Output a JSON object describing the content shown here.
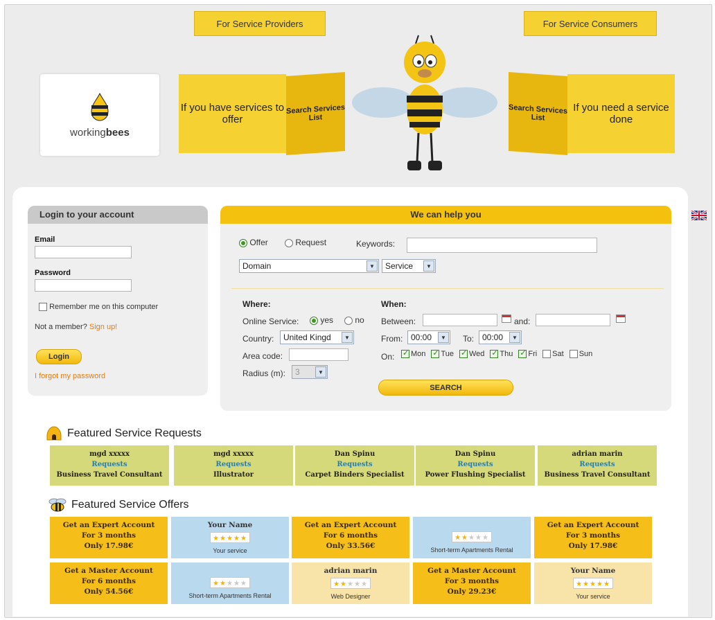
{
  "header": {
    "tab_providers": "For Service Providers",
    "tab_consumers": "For Service Consumers",
    "logo_text_plain": "working",
    "logo_text_bold": "bees",
    "box_left_face": "If you have services to offer",
    "box_left_side": "Search Services List",
    "box_right_side": "Search Services List",
    "box_right_face": "If you need a service done"
  },
  "login": {
    "title": "Login to your account",
    "email_label": "Email",
    "email_value": "",
    "password_label": "Password",
    "password_value": "",
    "remember_label": "Remember me on this computer",
    "not_member": "Not a member?",
    "signup": "Sign up!",
    "login_button": "Login",
    "forgot": "I forgot my password"
  },
  "search": {
    "title": "We can help you",
    "offer_label": "Offer",
    "request_label": "Request",
    "keywords_label": "Keywords:",
    "keywords_value": "",
    "domain_select": "Domain",
    "service_select": "Service",
    "where_title": "Where:",
    "online_label": "Online Service:",
    "yes_label": "yes",
    "no_label": "no",
    "country_label": "Country:",
    "country_value": "United Kingd",
    "area_label": "Area code:",
    "radius_label": "Radius (m):",
    "radius_value": "3",
    "when_title": "When:",
    "between_label": "Between:",
    "and_label": "and:",
    "from_label": "From:",
    "from_value": "00:00",
    "to_label": "To:",
    "to_value": "00:00",
    "on_label": "On:",
    "days": [
      "Mon",
      "Tue",
      "Wed",
      "Thu",
      "Fri",
      "Sat",
      "Sun"
    ],
    "days_checked": [
      true,
      true,
      true,
      true,
      true,
      false,
      false
    ],
    "search_button": "SEARCH"
  },
  "featured_requests": {
    "title": "Featured Service Requests",
    "items": [
      {
        "name": "mgd xxxxx",
        "link": "Requests",
        "service": "Business Travel Consultant"
      },
      {
        "name": "mgd xxxxx",
        "link": "Requests",
        "service": "Illustrator"
      },
      {
        "name": "Dan Spinu",
        "link": "Requests",
        "service": "Carpet Binders Specialist"
      },
      {
        "name": "Dan Spinu",
        "link": "Requests",
        "service": "Power Flushing Specialist"
      },
      {
        "name": "adrian marin",
        "link": "Requests",
        "service": "Business Travel Consultant"
      }
    ]
  },
  "featured_offers": {
    "title": "Featured Service Offers",
    "row1": [
      {
        "l1": "Get an Expert Account",
        "l2": "For 3 months",
        "l3": "Only 17.98€"
      },
      {
        "name": "Your Name",
        "sub": "Your service",
        "stars": 5
      },
      {
        "l1": "Get an Expert Account",
        "l2": "For 6 months",
        "l3": "Only 33.56€"
      },
      {
        "sub": "Short-term Apartments Rental",
        "stars": 2
      },
      {
        "l1": "Get an Expert Account",
        "l2": "For 3 months",
        "l3": "Only 17.98€"
      }
    ],
    "row2": [
      {
        "l1": "Get a Master Account",
        "l2": "For 6 months",
        "l3": "Only 54.56€"
      },
      {
        "sub": "Short-term Apartments Rental",
        "stars": 2
      },
      {
        "name": "adrian marin",
        "sub": "Web Designer",
        "stars": 2
      },
      {
        "l1": "Get a Master Account",
        "l2": "For 3 months",
        "l3": "Only 29.23€"
      },
      {
        "name": "Your Name",
        "sub": "Your service",
        "stars": 5
      }
    ]
  },
  "colors": {
    "accent_yellow": "#f5c10f",
    "request_green": "#d6d97a",
    "offer_gold": "#f5be18",
    "offer_blue": "#b9d9ef",
    "link_orange": "#e87c12"
  }
}
